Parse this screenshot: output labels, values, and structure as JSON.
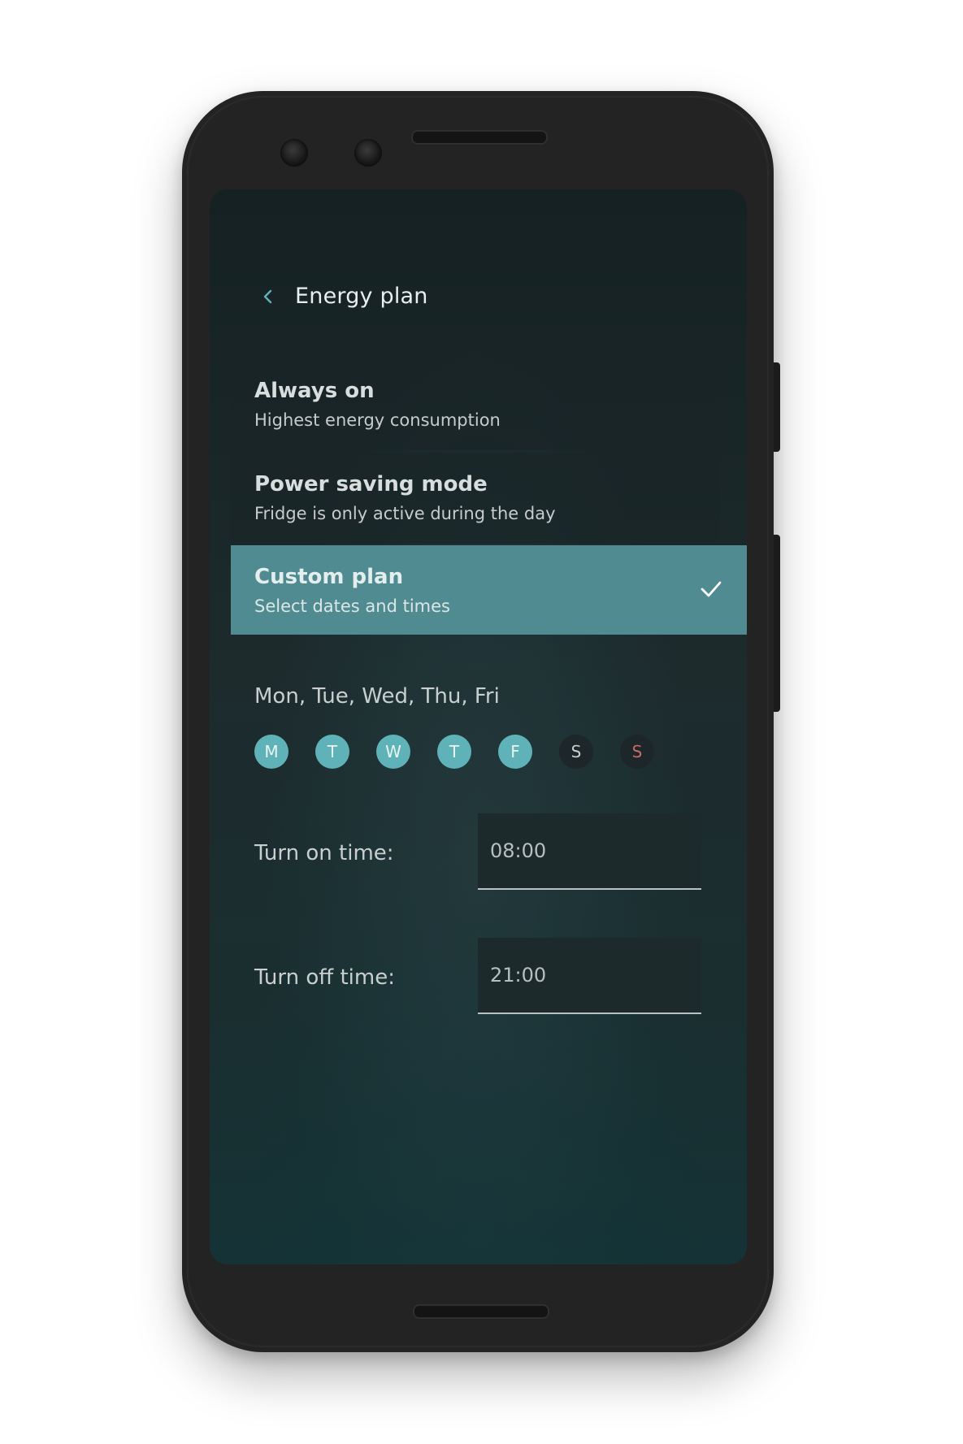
{
  "header": {
    "title": "Energy plan",
    "back_icon": "chevron-left-icon"
  },
  "options": [
    {
      "title": "Always on",
      "subtitle": "Highest energy consumption",
      "selected": false
    },
    {
      "title": "Power saving mode",
      "subtitle": "Fridge is only active during the day",
      "selected": false
    },
    {
      "title": "Custom plan",
      "subtitle": "Select dates and times",
      "selected": true,
      "icon": "check-icon"
    }
  ],
  "days": {
    "summary": "Mon, Tue, Wed, Thu, Fri",
    "items": [
      {
        "letter": "M",
        "active": true
      },
      {
        "letter": "T",
        "active": true
      },
      {
        "letter": "W",
        "active": true
      },
      {
        "letter": "T",
        "active": true
      },
      {
        "letter": "F",
        "active": true
      },
      {
        "letter": "S",
        "active": false
      },
      {
        "letter": "S",
        "active": false
      }
    ]
  },
  "schedule": {
    "on_label": "Turn on time:",
    "on_value": "08:00",
    "off_label": "Turn off time:",
    "off_value": "21:00"
  },
  "colors": {
    "accent": "#5fb3b8",
    "selected_row": "#4f8b90",
    "weekend_highlight": "#c96b6b"
  }
}
